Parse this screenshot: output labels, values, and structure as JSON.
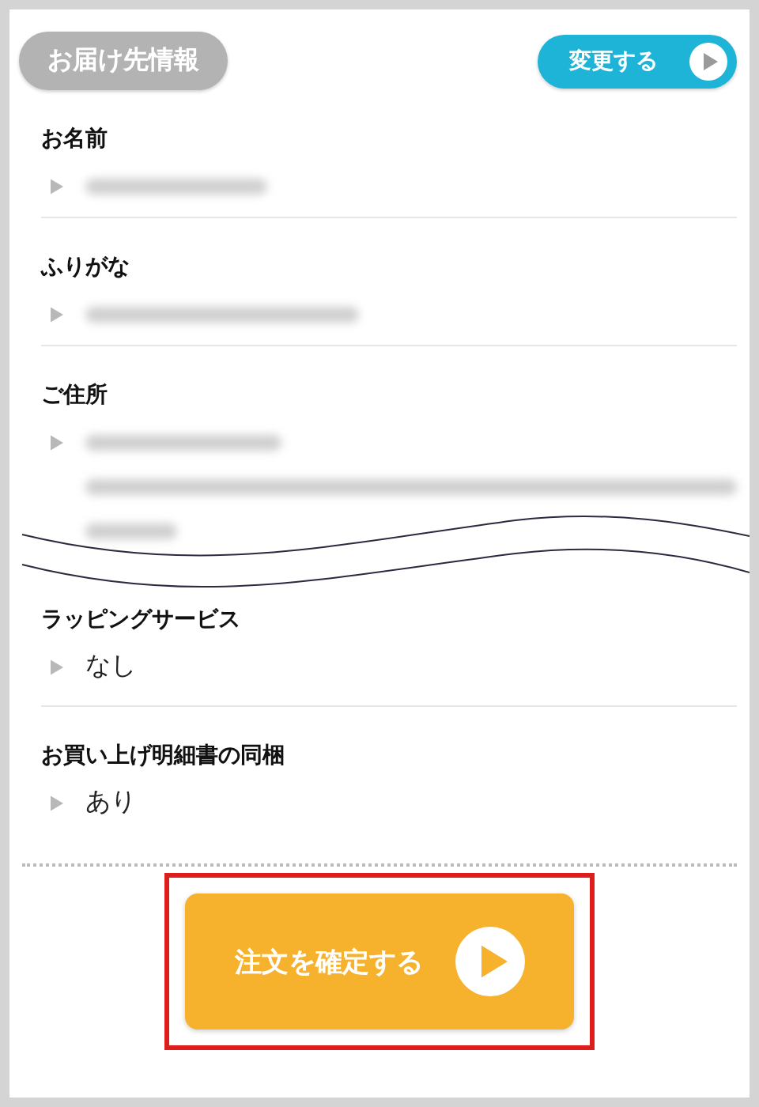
{
  "header": {
    "title": "お届け先情報",
    "change_button": "変更する"
  },
  "sections": [
    {
      "label": "お名前",
      "kind": "blurred"
    },
    {
      "label": "ふりがな",
      "kind": "blurred_wide"
    },
    {
      "label": "ご住所",
      "kind": "blurred_block"
    }
  ],
  "options": [
    {
      "label": "ラッピングサービス",
      "kind": "text",
      "value": "なし"
    },
    {
      "label": "お買い上げ明細書の同梱",
      "kind": "text",
      "value": "あり"
    }
  ],
  "confirm_button": {
    "label": "注文を確定する",
    "highlighted": true
  }
}
